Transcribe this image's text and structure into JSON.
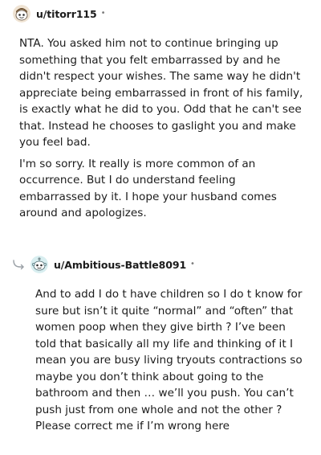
{
  "comments": [
    {
      "username": "u/titorr115",
      "dot": "•",
      "avatar": "avatar-snoo-brown-icon",
      "paragraphs": [
        "NTA. You asked him not to continue bringing up something that you felt embarrassed by and he didn't respect your wishes. The same way he didn't appreciate being embarrassed in front of his family, is exactly what he did to you. Odd that he can't see that. Instead he chooses to gaslight you and make you feel bad.",
        "I'm so sorry. It really is more common of an occurrence. But I do understand feeling embarrassed by it. I hope your husband comes around and apologizes."
      ]
    },
    {
      "username": "u/Ambitious-Battle8091",
      "dot": "•",
      "avatar": "avatar-snoo-teal-icon",
      "reply_icon": "reply-arrow-icon",
      "paragraphs": [
        "And to add I do t have children so I do t know for sure but isn’t it quite “normal” and “often” that women poop when they give birth ? I’ve been told that basically all my life and thinking of it I mean you are busy living tryouts contractions so maybe you don’t think about going to the bathroom and then … we’ll you push. You can’t push just from one whole and not the other ? Please correct me if I’m wrong here"
      ]
    }
  ],
  "colors": {
    "text": "#1c1c1c",
    "muted": "#7c7c7c"
  }
}
